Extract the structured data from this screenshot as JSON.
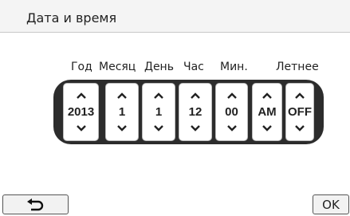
{
  "title": "Дата и время",
  "columns": [
    {
      "label": "Год",
      "value": "2013"
    },
    {
      "label": "Месяц",
      "value": "1"
    },
    {
      "label": "День",
      "value": "1"
    },
    {
      "label": "Час",
      "value": "12"
    },
    {
      "label": "Мин.",
      "value": "00"
    },
    {
      "label": "",
      "value": "AM"
    },
    {
      "label": "Летнее",
      "value": "OFF"
    }
  ],
  "buttons": {
    "back_icon": "return-arrow-icon",
    "ok_label": "OK"
  },
  "colors": {
    "panel": "#2c2c2c",
    "titlebar": "#f4f4f4"
  }
}
